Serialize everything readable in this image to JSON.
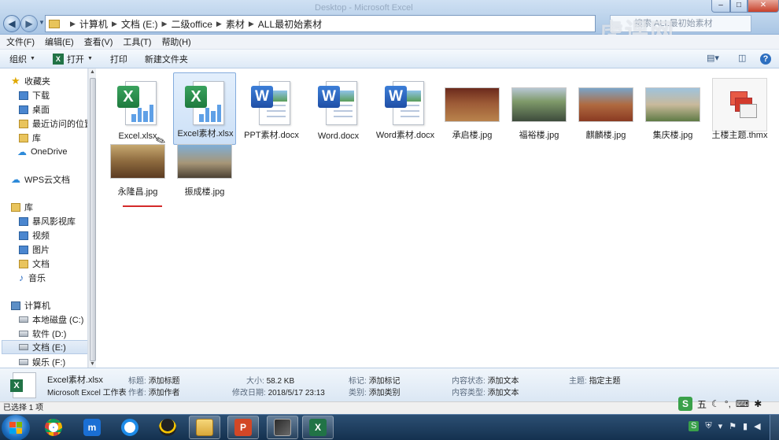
{
  "window": {
    "ghost_title": "Desktop - Microsoft Excel",
    "controls": {
      "minimize": "–",
      "maximize": "□",
      "close": "✕"
    }
  },
  "address": {
    "crumbs": [
      "计算机",
      "文档 (E:)",
      "二级office",
      "素材",
      "ALL最初始素材"
    ]
  },
  "search": {
    "placeholder": "搜索 ALL最初始素材"
  },
  "watermark": "虎课网",
  "menu": [
    "文件(F)",
    "编辑(E)",
    "查看(V)",
    "工具(T)",
    "帮助(H)"
  ],
  "toolbar": {
    "organize": "组织",
    "open": "打开",
    "print": "打印",
    "new_folder": "新建文件夹"
  },
  "nav": {
    "favorites": "收藏夹",
    "downloads": "下载",
    "desktop": "桌面",
    "recent": "最近访问的位置",
    "library_fav": "库",
    "onedrive": "OneDrive",
    "wps_cloud": "WPS云文档",
    "libraries": "库",
    "baofeng": "暴风影视库",
    "videos": "视频",
    "pictures": "图片",
    "documents": "文档",
    "music": "音乐",
    "computer": "计算机",
    "drive_c": "本地磁盘 (C:)",
    "drive_d": "软件 (D:)",
    "drive_e": "文档 (E:)",
    "drive_f": "娱乐 (F:)"
  },
  "files": [
    {
      "name": "Excel.xlsx",
      "type": "excel"
    },
    {
      "name": "Excel素材.xlsx",
      "type": "excel",
      "selected": true
    },
    {
      "name": "PPT素材.docx",
      "type": "word"
    },
    {
      "name": "Word.docx",
      "type": "word"
    },
    {
      "name": "Word素材.docx",
      "type": "word"
    },
    {
      "name": "承启楼.jpg",
      "type": "image",
      "colors": [
        "#6b2a1c",
        "#b9834c"
      ]
    },
    {
      "name": "福裕楼.jpg",
      "type": "image",
      "colors": [
        "#7f9a6a",
        "#3d4b3c"
      ]
    },
    {
      "name": "麒麟楼.jpg",
      "type": "image",
      "colors": [
        "#7aa4c8",
        "#8a3a22"
      ]
    },
    {
      "name": "集庆楼.jpg",
      "type": "image",
      "colors": [
        "#9fc3dc",
        "#5f7a45"
      ]
    },
    {
      "name": "土楼主题.thmx",
      "type": "theme"
    },
    {
      "name": "永隆昌.jpg",
      "type": "image",
      "colors": [
        "#c6a870",
        "#5b3b22"
      ]
    },
    {
      "name": "振成楼.jpg",
      "type": "image",
      "colors": [
        "#7eaed6",
        "#4b4133"
      ]
    }
  ],
  "details": {
    "name": "Excel素材.xlsx",
    "filetype": "Microsoft Excel 工作表",
    "title_k": "标题:",
    "title_v": "添加标题",
    "author_k": "作者:",
    "author_v": "添加作者",
    "size_k": "大小:",
    "size_v": "58.2 KB",
    "modified_k": "修改日期:",
    "modified_v": "2018/5/17 23:13",
    "tags_k": "标记:",
    "tags_v": "添加标记",
    "category_k": "类别:",
    "category_v": "添加类别",
    "content_status_k": "内容状态:",
    "content_status_v": "添加文本",
    "content_type_k": "内容类型:",
    "content_type_v": "添加文本",
    "subject_k": "主题:",
    "subject_v": "指定主题"
  },
  "status": {
    "selected": "已选择 1 项"
  },
  "ime": {
    "logo": "S",
    "mode": "五",
    "moon": "☾",
    "punct": "°,",
    "keyboard": "⌨",
    "wrench": "✱"
  },
  "taskbar": {
    "apps": [
      "chrome-icon",
      "maxthon-icon",
      "sync-icon",
      "qq-icon",
      "explorer-icon",
      "powerpoint-icon",
      "media-icon",
      "excel-icon"
    ],
    "tray_logo": "S"
  }
}
